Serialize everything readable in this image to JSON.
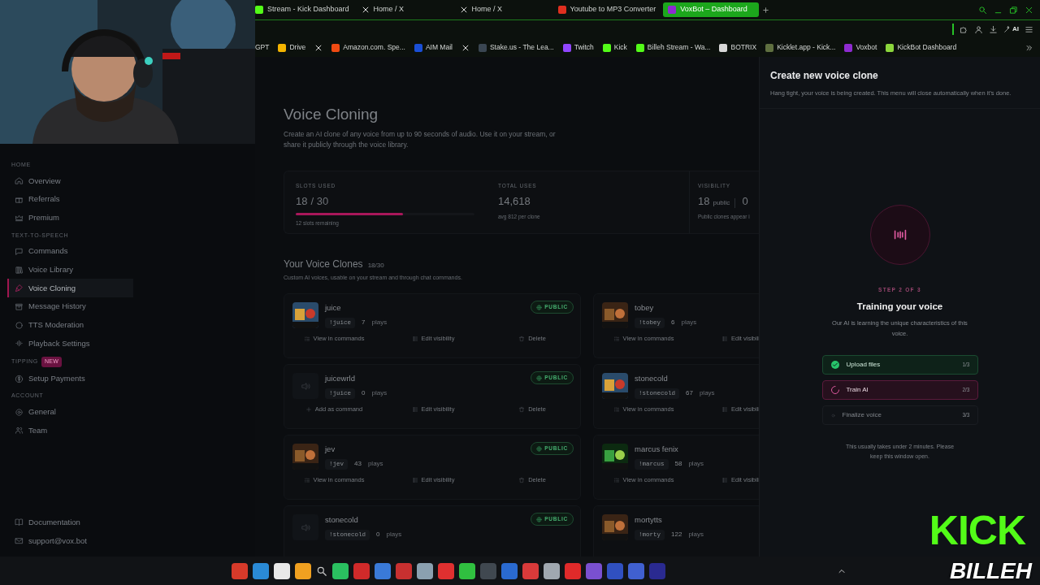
{
  "browser": {
    "tabs": [
      {
        "label": "Stream - Kick Dashboard",
        "selected": false
      },
      {
        "label": "Home / X",
        "selected": false
      },
      {
        "label": "Home / X",
        "selected": false
      },
      {
        "label": "Youtube to MP3 Converter",
        "selected": false
      },
      {
        "label": "VoxBot – Dashboard",
        "selected": true
      }
    ],
    "ai_button": "AI",
    "bookmarks": [
      {
        "kind": "link",
        "label": "GPT"
      },
      {
        "kind": "link",
        "label": "Drive"
      },
      {
        "kind": "icon"
      },
      {
        "kind": "link",
        "label": "Amazon.com. Spe..."
      },
      {
        "kind": "link",
        "label": "AIM Mail"
      },
      {
        "kind": "icon"
      },
      {
        "kind": "link",
        "label": "Stake.us - The Lea..."
      },
      {
        "kind": "link",
        "label": "Twitch"
      },
      {
        "kind": "link",
        "label": "Kick"
      },
      {
        "kind": "link",
        "label": "Billeh Stream - Wa..."
      },
      {
        "kind": "link",
        "label": "BOTRIX"
      },
      {
        "kind": "link",
        "label": "Kicklet.app - Kick..."
      },
      {
        "kind": "link",
        "label": "Voxbot"
      },
      {
        "kind": "link",
        "label": "KickBot Dashboard"
      }
    ]
  },
  "sidebar": {
    "sections": [
      {
        "heading": "HOME",
        "items": [
          {
            "label": "Overview",
            "selected": false
          },
          {
            "label": "Referrals",
            "selected": false
          },
          {
            "label": "Premium",
            "selected": false
          }
        ]
      },
      {
        "heading": "TEXT-TO-SPEECH",
        "items": [
          {
            "label": "Commands",
            "selected": false
          },
          {
            "label": "Voice Library",
            "selected": false
          },
          {
            "label": "Voice Cloning",
            "selected": true
          },
          {
            "label": "Message History",
            "selected": false
          },
          {
            "label": "TTS Moderation",
            "selected": false
          },
          {
            "label": "Playback Settings",
            "selected": false
          }
        ]
      },
      {
        "heading": "TIPPING",
        "badge": "NEW",
        "items": [
          {
            "label": "Setup Payments",
            "selected": false
          }
        ]
      },
      {
        "heading": "ACCOUNT",
        "items": [
          {
            "label": "General",
            "selected": false
          },
          {
            "label": "Team",
            "selected": false
          }
        ]
      }
    ],
    "footer_links": [
      {
        "label": "Documentation"
      },
      {
        "label": "support@vox.bot"
      }
    ]
  },
  "page": {
    "title": "Voice Cloning",
    "description": "Create an AI clone of any voice from up to 90 seconds of audio. Use it on your stream, or share it publicly through the voice library.",
    "stats": [
      {
        "kind": "slots",
        "label": "SLOTS USED",
        "value": "18",
        "suffix": "/ 30",
        "level": 0.6,
        "note": "12 slots remaining"
      },
      {
        "kind": "total",
        "label": "TOTAL USES",
        "value": "14,618",
        "note": "avg 812 per clone"
      },
      {
        "kind": "visibility",
        "label": "VISIBILITY",
        "value": "18",
        "suffix": "public",
        "value2": "0",
        "note": "Public clones appear i"
      }
    ],
    "clones_title": "Your Voice Clones",
    "clones_count": "18/30",
    "clones_description": "Custom AI voices, usable on your stream and through chat commands.",
    "clones": [
      {
        "kind": "picture",
        "name": "juice",
        "command": "!juice",
        "plays": "7",
        "plays_label": "plays",
        "badge": "PUBLIC",
        "actions": [
          {
            "kind": "view",
            "label": "View in commands"
          },
          {
            "kind": "edit",
            "label": "Edit visibility"
          },
          {
            "kind": "delete",
            "label": "Delete"
          }
        ]
      },
      {
        "kind": "picture",
        "name": "tobey",
        "command": "!tobey",
        "plays": "6",
        "plays_label": "plays",
        "actions": [
          {
            "kind": "view",
            "label": "View in commands"
          },
          {
            "kind": "edit",
            "label": "Edit visibili"
          }
        ]
      },
      {
        "kind": "speaker",
        "name": "juicewrld",
        "command": "!juice",
        "plays": "0",
        "plays_label": "plays",
        "badge": "PUBLIC",
        "actions": [
          {
            "kind": "add",
            "label": "Add as command"
          },
          {
            "kind": "edit",
            "label": "Edit visibility"
          },
          {
            "kind": "delete",
            "label": "Delete"
          }
        ]
      },
      {
        "kind": "picture",
        "name": "stonecold",
        "command": "!stonecold",
        "plays": "67",
        "plays_label": "plays",
        "actions": [
          {
            "kind": "view",
            "label": "View in commands"
          },
          {
            "kind": "edit",
            "label": "Edit visibili"
          }
        ]
      },
      {
        "kind": "picture",
        "name": "jev",
        "command": "!jev",
        "plays": "43",
        "plays_label": "plays",
        "badge": "PUBLIC",
        "actions": [
          {
            "kind": "view",
            "label": "View in commands"
          },
          {
            "kind": "edit",
            "label": "Edit visibility"
          },
          {
            "kind": "delete",
            "label": "Delete"
          }
        ]
      },
      {
        "kind": "picture",
        "name": "marcus fenix",
        "command": "!marcus",
        "plays": "58",
        "plays_label": "plays",
        "actions": [
          {
            "kind": "view",
            "label": "View in commands"
          },
          {
            "kind": "edit",
            "label": "Edit visibili"
          }
        ]
      },
      {
        "kind": "speaker",
        "name": "stonecold",
        "command": "!stonecold",
        "plays": "0",
        "plays_label": "plays",
        "badge": "PUBLIC"
      },
      {
        "kind": "picture",
        "name": "mortytts",
        "command": "!morty",
        "plays": "122",
        "plays_label": "plays"
      }
    ]
  },
  "panel": {
    "title": "Create new voice clone",
    "description": "Hang tight, your voice is being created. This menu will close automatically when it's done.",
    "step_label": "STEP 2 OF 3",
    "heading": "Training your voice",
    "text": "Our AI is learning the unique characteristics of this voice.",
    "steps": [
      {
        "kind": "done",
        "label": "Upload files",
        "count": "1/3"
      },
      {
        "kind": "active",
        "label": "Train AI",
        "count": "2/3"
      },
      {
        "kind": "pending",
        "label": "Finalize voice",
        "count": "3/3"
      }
    ],
    "footnote": "This usually takes under 2 minutes. Please keep this window open."
  },
  "overlay_logo": {
    "top": "KICK",
    "bottom": "BILLEH"
  }
}
